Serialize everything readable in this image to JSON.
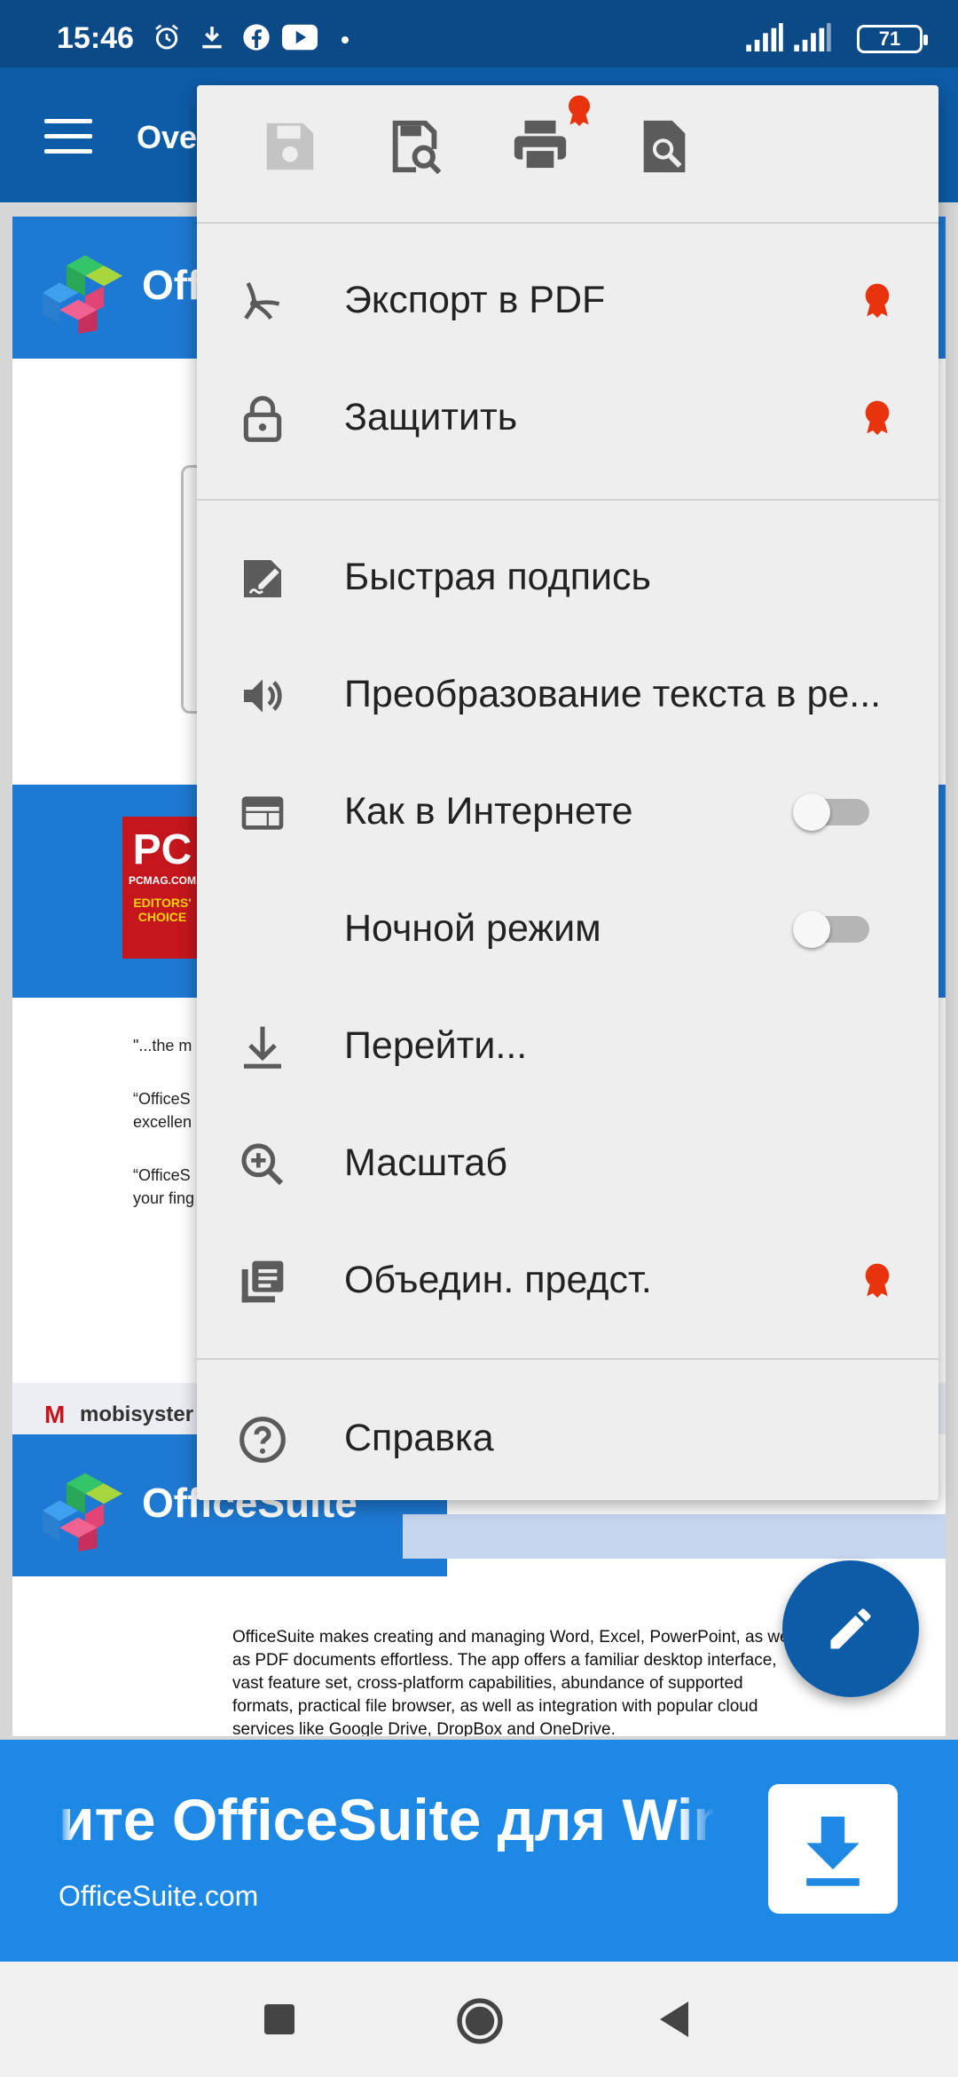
{
  "status_bar": {
    "time": "15:46",
    "battery": "71",
    "icons": [
      "alarm-icon",
      "download-icon",
      "facebook-icon",
      "youtube-icon",
      "dot-icon",
      "signal-icon",
      "signal-icon-2",
      "battery-icon"
    ]
  },
  "app_bar": {
    "title": "Ove",
    "menu_icon": "hamburger-icon"
  },
  "document": {
    "page1": {
      "brand": "Offi",
      "pcmag": {
        "big": "PC",
        "small": "PCMAG.COM",
        "editors": "EDITORS' CHOICE"
      },
      "quotes": [
        "\"...the m",
        "“OfficeS",
        "excellen",
        "“OfficeS",
        "your fing"
      ],
      "footer_brand": "mobisyster"
    },
    "page2": {
      "brand": "OfficeSuite",
      "body": "OfficeSuite makes creating and managing Word, Excel, PowerPoint, as well as PDF documents effortless. The app offers a familiar desktop interface, vast feature set, cross-platform capabilities, abundance of supported formats, practical file browser, as well as integration with popular cloud services like Google Drive, DropBox and OneDrive."
    }
  },
  "menu": {
    "toolbar_icons": [
      "save-icon",
      "save-as-icon",
      "print-icon",
      "find-icon"
    ],
    "items": [
      {
        "label": "Экспорт в PDF",
        "icon": "export-pdf-icon",
        "premium": true
      },
      {
        "label": "Защитить",
        "icon": "lock-icon",
        "premium": true
      },
      {
        "label": "Быстрая подпись",
        "icon": "signature-icon",
        "premium": false
      },
      {
        "label": "Преобразование текста в ре...",
        "icon": "speaker-icon",
        "premium": false
      },
      {
        "label": "Как в Интернете",
        "icon": "web-layout-icon",
        "toggle": false
      },
      {
        "label": "Ночной режим",
        "icon": "moon-icon",
        "toggle": false
      },
      {
        "label": "Перейти...",
        "icon": "go-to-icon",
        "premium": false
      },
      {
        "label": "Масштаб",
        "icon": "zoom-icon",
        "premium": false
      },
      {
        "label": "Объедин. предст.",
        "icon": "merge-view-icon",
        "premium": true
      },
      {
        "label": "Справка",
        "icon": "help-icon",
        "premium": false
      }
    ]
  },
  "ad": {
    "headline": "ите OfficeSuite для Windows",
    "url": "OfficeSuite.com"
  },
  "colors": {
    "primary": "#0d5ca8",
    "accent": "#1e88e5",
    "premium": "#e8340c"
  }
}
